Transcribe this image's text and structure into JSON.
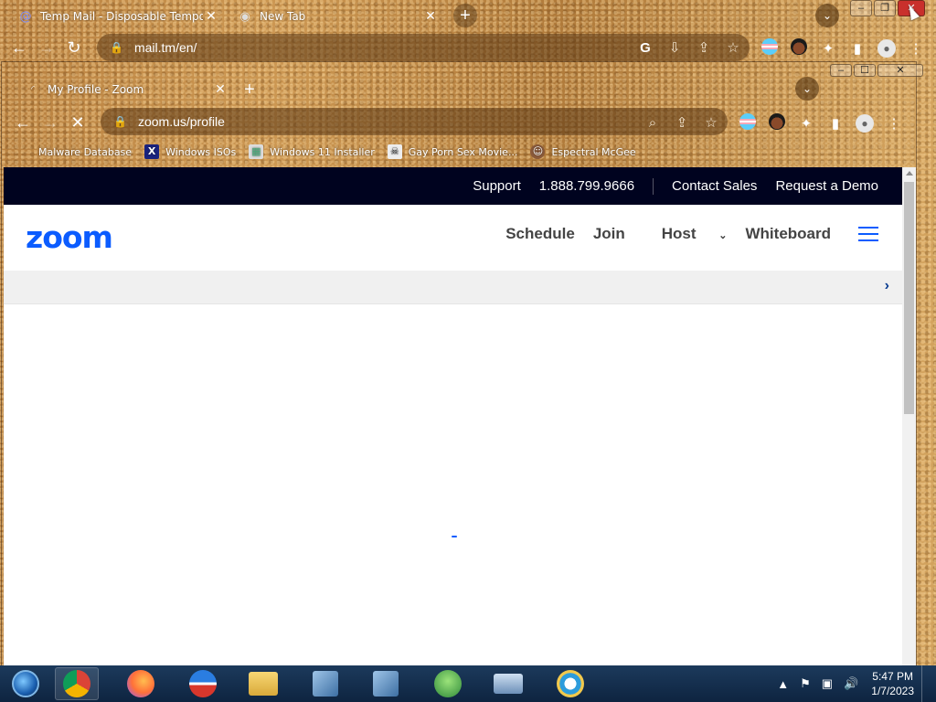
{
  "outer_window": {
    "tabs": [
      {
        "title": "Temp Mail - Disposable Temporar",
        "icon": "at-icon"
      },
      {
        "title": "New Tab",
        "icon": "chrome-icon"
      }
    ],
    "url": "mail.tm/en/"
  },
  "front_window": {
    "tab_title": "My Profile - Zoom",
    "url": "zoom.us/profile",
    "bookmarks": [
      {
        "label": "Malware Database"
      },
      {
        "label": "Windows ISOs"
      },
      {
        "label": "Windows 11 Installer"
      },
      {
        "label": "Gay Porn Sex Movie..."
      },
      {
        "label": "Espectral McGee"
      }
    ]
  },
  "zoom_page": {
    "topbar": {
      "support": "Support",
      "phone": "1.888.799.9666",
      "contact_sales": "Contact Sales",
      "request_demo": "Request a Demo"
    },
    "logo": "zoom",
    "nav": {
      "schedule": "Schedule",
      "join": "Join",
      "host": "Host",
      "whiteboard": "Whiteboard"
    }
  },
  "taskbar": {
    "time": "5:47 PM",
    "date": "1/7/2023"
  },
  "colors": {
    "zoom_blue": "#0b5cff",
    "topbar_bg": "#00031f"
  }
}
